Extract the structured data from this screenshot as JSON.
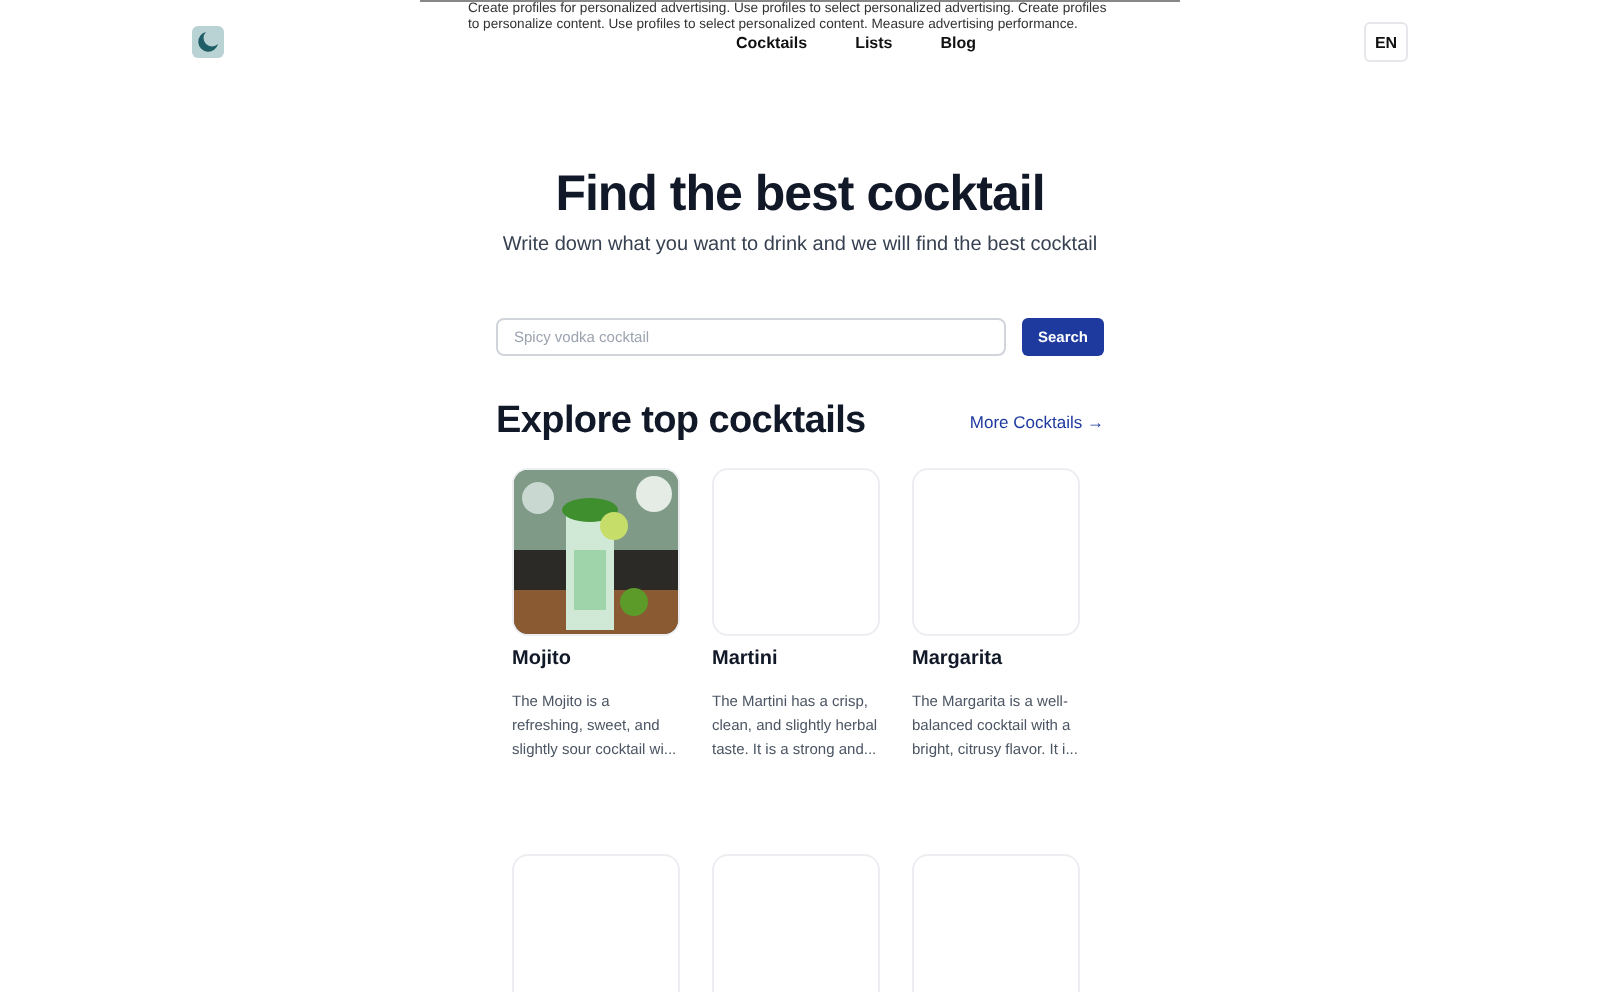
{
  "consent_banner": {
    "lines": [
      "Create profiles for personalized advertising. Use profiles to select personalized advertising. Create profiles",
      "to personalize content. Use profiles to select personalized content. Measure advertising performance."
    ]
  },
  "nav": {
    "links": [
      "Cocktails",
      "Lists",
      "Blog"
    ],
    "language": "EN"
  },
  "hero": {
    "title": "Find the best cocktail",
    "subtitle": "Write down what you want to drink and we will find the best cocktail"
  },
  "search": {
    "placeholder": "Spicy vodka cocktail",
    "button": "Search"
  },
  "section": {
    "title": "Explore top cocktails",
    "more_link": "More Cocktails",
    "more_arrow": "→"
  },
  "cocktails": [
    {
      "kind": "loaded",
      "name": "Mojito",
      "description": "The Mojito is a refreshing, sweet, and slightly sour cocktail wi..."
    },
    {
      "kind": "loaded",
      "name": "Martini",
      "description": "The Martini has a crisp, clean, and slightly herbal taste. It is a strong and..."
    },
    {
      "kind": "loaded",
      "name": "Margarita",
      "description": "The Margarita is a well-balanced cocktail with a bright, citrusy flavor. It i..."
    },
    {
      "kind": "loading"
    },
    {
      "kind": "loading"
    },
    {
      "kind": "loading"
    }
  ]
}
